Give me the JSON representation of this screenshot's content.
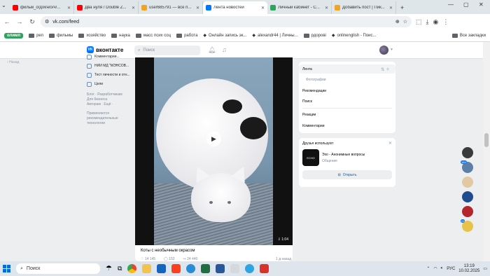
{
  "browser": {
    "tabs": [
      {
        "label": "фильм_о/д/и/н/о/ч/...",
        "color": "#ff0000"
      },
      {
        "label": "Два нуля / Double Z...",
        "color": "#ff0000"
      },
      {
        "label": "user685791 — все п...",
        "color": "#f4a224"
      },
      {
        "label": "Лента новостей",
        "color": "#0077ff",
        "active": true
      },
      {
        "label": "Личный кабинет - С...",
        "color": "#2ea35e"
      },
      {
        "label": "Добавить пост | Пик...",
        "color": "#f4a224"
      }
    ],
    "url": "vk.com/feed",
    "bookmarks": [
      {
        "label": "олимп",
        "type": "pill"
      },
      {
        "label": "реп",
        "type": "folder"
      },
      {
        "label": "фильмы",
        "type": "folder"
      },
      {
        "label": "хозяйство",
        "type": "folder"
      },
      {
        "label": "наука",
        "type": "folder"
      },
      {
        "label": "масс псих соц",
        "type": "folder"
      },
      {
        "label": "работа",
        "type": "folder"
      },
      {
        "label": "Онлайн запись эк...",
        "type": "site"
      },
      {
        "label": "alexandr44 | Личны...",
        "type": "site"
      },
      {
        "label": "рдорові",
        "type": "folder"
      },
      {
        "label": "onlinenglish - Поис...",
        "type": "site"
      }
    ],
    "all_bookmarks": "Все закладки"
  },
  "vk": {
    "logo": "вконтакте",
    "search_placeholder": "Поиск",
    "back": "Назад",
    "left_nav": [
      {
        "label": "Комментарии..."
      },
      {
        "label": "НИИ МД \"МЭНСОВ..."
      },
      {
        "label": "Тест личности и отн..."
      },
      {
        "label": "Цели"
      }
    ],
    "footer": [
      "Блог · Разработчикам",
      "Для бизнеса",
      "Авторам · Ещё ·"
    ],
    "footer_note": "Применяются рекомендательные технологии",
    "post": {
      "caption": "Коты с необычным окрасом",
      "duration": "1:04",
      "likes": "14 145",
      "comments": "152",
      "views": "24 440",
      "time": "1 д назад"
    },
    "filters": {
      "items": [
        "Лента",
        "Фотографии",
        "Рекомендации",
        "Поиск",
        "Реакции",
        "Комментарии"
      ]
    },
    "friends": {
      "title": "Друзья используют",
      "app_name": "Эхо - Анонимные вопросы",
      "app_sub": "Общение",
      "app_icon_text": "ECHO",
      "open_label": "Открыть"
    },
    "friend_badges": [
      "164",
      "21"
    ]
  },
  "taskbar": {
    "search_label": "Поиск",
    "lang": "РУС",
    "time": "13:19",
    "date": "10.02.2025"
  }
}
